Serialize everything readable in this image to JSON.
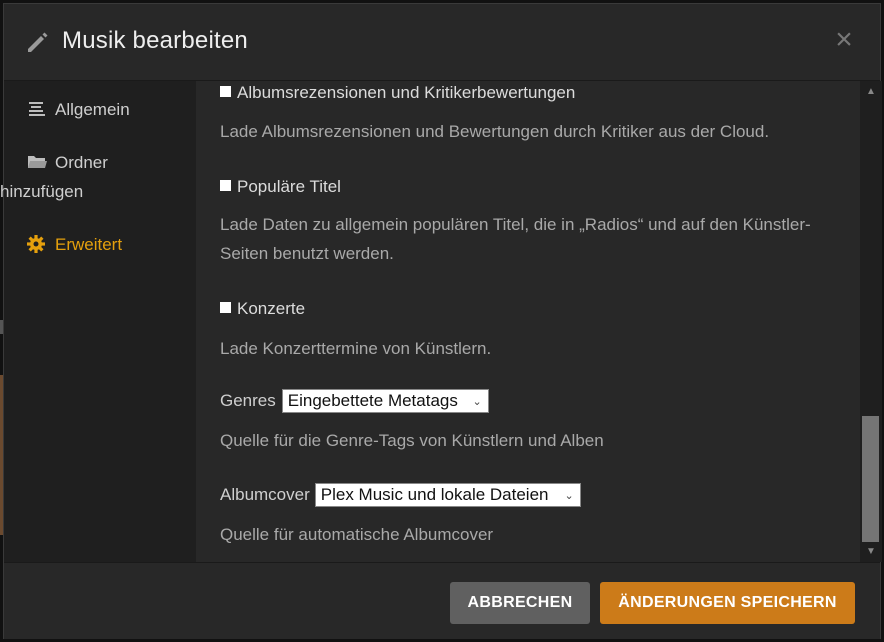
{
  "dialog": {
    "title": "Musik bearbeiten",
    "icons": {
      "title": "pencil-icon",
      "close": "close-icon"
    }
  },
  "sidebar": {
    "items": [
      {
        "label": "Allgemein",
        "icon": "list-icon",
        "active": false
      },
      {
        "label": "Ordner hinzufügen",
        "label_line1": "Ordner",
        "label_line2": "hinzufügen",
        "icon": "folder-icon",
        "active": false
      },
      {
        "label": "Erweitert",
        "icon": "gear-icon",
        "active": true
      }
    ],
    "active_color": "#e5a00d"
  },
  "settings": {
    "album_reviews": {
      "label": "Albumsrezensionen und Kritikerbewertungen",
      "checked": false,
      "description": "Lade Albumsrezensionen und Bewertungen durch Kritiker aus der Cloud."
    },
    "popular_tracks": {
      "label": "Populäre Titel",
      "checked": false,
      "description": "Lade Daten zu allgemein populären Titel, die in „Radios“ und auf den Künstler-Seiten benutzt werden."
    },
    "concerts": {
      "label": "Konzerte",
      "checked": false,
      "description": "Lade Konzerttermine von Künstlern."
    },
    "genres": {
      "label": "Genres",
      "value": "Eingebettete Metatags",
      "description": "Quelle für die Genre-Tags von Künstlern und Alben"
    },
    "album_art": {
      "label": "Albumcover",
      "value": "Plex Music und lokale Dateien",
      "description": "Quelle für automatische Albumcover"
    }
  },
  "footer": {
    "cancel_label": "ABBRECHEN",
    "save_label": "ÄNDERUNGEN SPEICHERN",
    "colors": {
      "cancel": "#606060",
      "save": "#cc7b19"
    }
  }
}
